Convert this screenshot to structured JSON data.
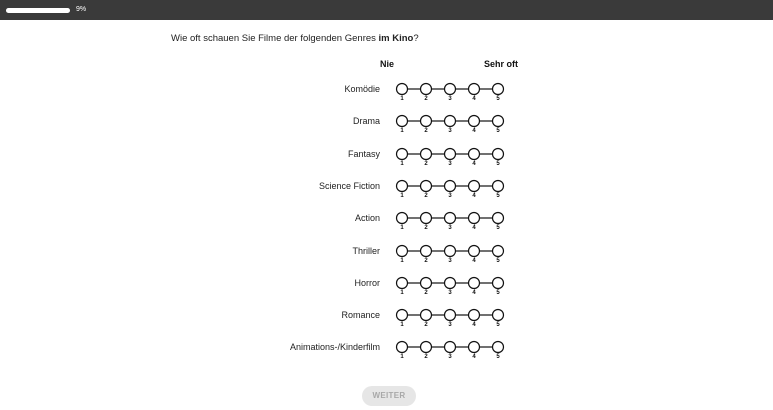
{
  "progress": {
    "label": "9%",
    "value": 0.09
  },
  "question": {
    "prefix": "Wie oft schauen Sie Filme der folgenden Genres ",
    "emphasis": "im Kino",
    "suffix": "?"
  },
  "scale": {
    "left_label": "Nie",
    "right_label": "Sehr oft",
    "points": [
      "1",
      "2",
      "3",
      "4",
      "5"
    ]
  },
  "rows": [
    {
      "label": "Komödie"
    },
    {
      "label": "Drama"
    },
    {
      "label": "Fantasy"
    },
    {
      "label": "Science Fiction"
    },
    {
      "label": "Action"
    },
    {
      "label": "Thriller"
    },
    {
      "label": "Horror"
    },
    {
      "label": "Romance"
    },
    {
      "label": "Animations-/Kinderfilm"
    }
  ],
  "footer": {
    "next_label": "WEITER"
  }
}
